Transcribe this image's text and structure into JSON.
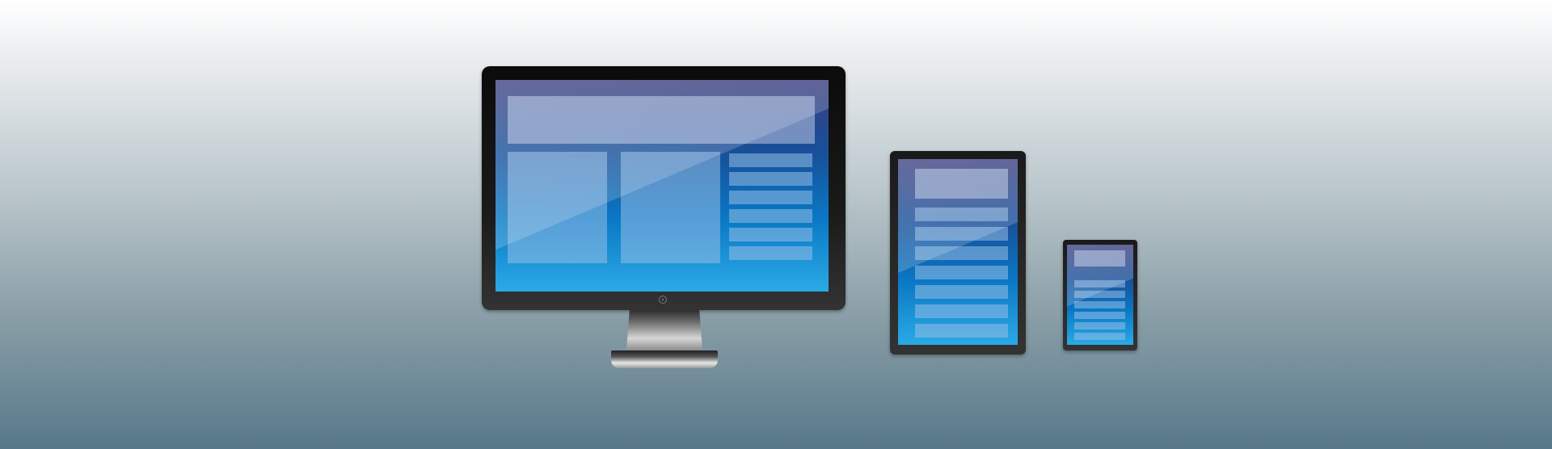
{
  "scene": {
    "description_icons": [
      "monitor-icon",
      "tablet-icon",
      "phone-icon"
    ],
    "colors": {
      "background_top": "#ffffff",
      "background_bottom": "#57788a",
      "bezel": "#111111",
      "screen_top": "#3c3f7f",
      "screen_bottom": "#2aaae6"
    }
  }
}
